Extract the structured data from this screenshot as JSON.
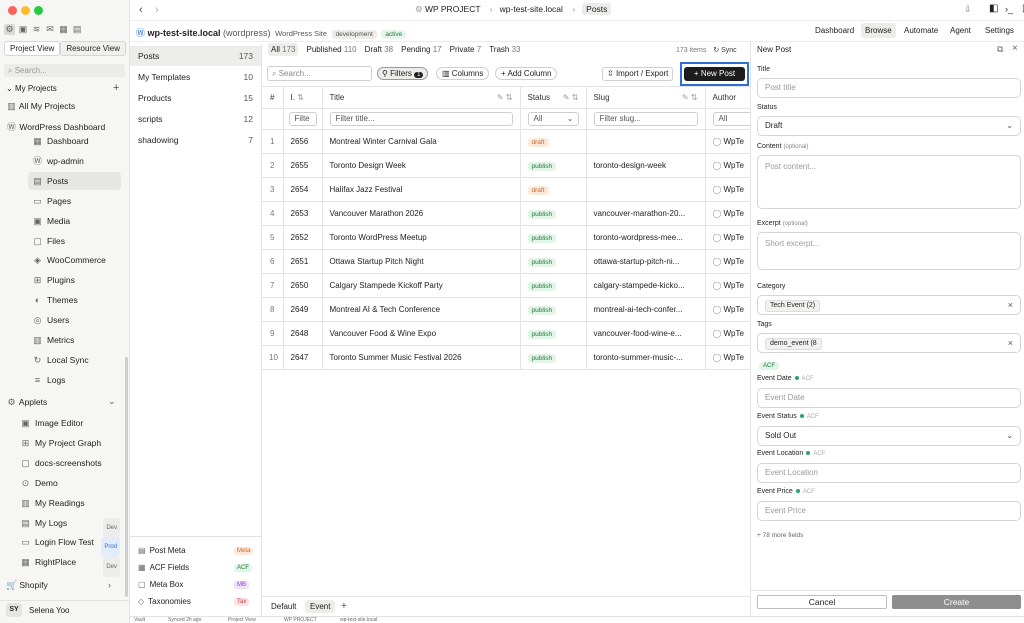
{
  "left": {
    "views": [
      "Project View",
      "Resource View"
    ],
    "search_placeholder": "Search...",
    "my_projects": "My Projects",
    "all_projects": "All My Projects",
    "project": "WordPress Dashboard",
    "items": [
      "Dashboard",
      "wp-admin",
      "Posts",
      "Pages",
      "Media",
      "Files",
      "WooCommerce",
      "Plugins",
      "Themes",
      "Users",
      "Metrics",
      "Local Sync",
      "Logs"
    ],
    "applets_label": "Applets",
    "applets": [
      {
        "label": "Image Editor",
        "badge": ""
      },
      {
        "label": "My Project Graph",
        "badge": ""
      },
      {
        "label": "docs-screenshots",
        "badge": ""
      },
      {
        "label": "Demo",
        "badge": ""
      },
      {
        "label": "My Readings",
        "badge": ""
      },
      {
        "label": "My Logs",
        "badge": "Dev"
      },
      {
        "label": "Login Flow Test",
        "badge": "Prod"
      },
      {
        "label": "RightPlace",
        "badge": "Dev"
      }
    ],
    "shopify": "Shopify",
    "user_initials": "SY",
    "user_name": "Selena Yoo"
  },
  "topbar": {
    "project": "WP PROJECT",
    "site": "wp-test-site.local",
    "page": "Posts",
    "site_name": "wp-test-site.local",
    "site_type": "(wordpress)",
    "site_label": "WordPress Site",
    "env": "development",
    "state": "active",
    "tabs": [
      "Dashboard",
      "Browse",
      "Automate",
      "Agent",
      "Settings"
    ]
  },
  "types": [
    {
      "label": "Posts",
      "count": "173"
    },
    {
      "label": "My Templates",
      "count": "10"
    },
    {
      "label": "Products",
      "count": "15"
    },
    {
      "label": "scripts",
      "count": "12"
    },
    {
      "label": "shadowing",
      "count": "7"
    }
  ],
  "bottom_types": [
    {
      "label": "Post Meta",
      "tag": "Meta"
    },
    {
      "label": "ACF Fields",
      "tag": "ACF"
    },
    {
      "label": "Meta Box",
      "tag": "MB"
    },
    {
      "label": "Taxonomies",
      "tag": "Tax"
    }
  ],
  "status_tabs": [
    {
      "label": "All",
      "count": "173"
    },
    {
      "label": "Published",
      "count": "110"
    },
    {
      "label": "Draft",
      "count": "38"
    },
    {
      "label": "Pending",
      "count": "17"
    },
    {
      "label": "Private",
      "count": "7"
    },
    {
      "label": "Trash",
      "count": "33"
    }
  ],
  "items_count": "173 items",
  "sync_label": "Sync",
  "toolbar": {
    "search_placeholder": "Search...",
    "filters": "Filters",
    "filters_count": "1",
    "columns": "Columns",
    "add_column": "+ Add Column",
    "import_export": "Import / Export",
    "new_post": "+ New Post"
  },
  "table": {
    "headers": [
      "#",
      "I.",
      "Title",
      "Status",
      "Slug",
      "Author"
    ],
    "filters": [
      "Filte",
      "Filter title...",
      "All",
      "Filter slug...",
      "All"
    ],
    "rows": [
      {
        "n": "1",
        "id": "2656",
        "title": "Montreal Winter Carnival Gala",
        "status": "draft",
        "slug": "",
        "author": "WpTe"
      },
      {
        "n": "2",
        "id": "2655",
        "title": "Toronto Design Week",
        "status": "publish",
        "slug": "toronto-design-week",
        "author": "WpTe"
      },
      {
        "n": "3",
        "id": "2654",
        "title": "Halifax Jazz Festival",
        "status": "draft",
        "slug": "",
        "author": "WpTe"
      },
      {
        "n": "4",
        "id": "2653",
        "title": "Vancouver Marathon 2026",
        "status": "publish",
        "slug": "vancouver-marathon-20...",
        "author": "WpTe"
      },
      {
        "n": "5",
        "id": "2652",
        "title": "Toronto WordPress Meetup",
        "status": "publish",
        "slug": "toronto-wordpress-mee...",
        "author": "WpTe"
      },
      {
        "n": "6",
        "id": "2651",
        "title": "Ottawa Startup Pitch Night",
        "status": "publish",
        "slug": "ottawa-startup-pitch-ni...",
        "author": "WpTe"
      },
      {
        "n": "7",
        "id": "2650",
        "title": "Calgary Stampede Kickoff Party",
        "status": "publish",
        "slug": "calgary-stampede-kicko...",
        "author": "WpTe"
      },
      {
        "n": "8",
        "id": "2649",
        "title": "Montreal AI & Tech Conference",
        "status": "publish",
        "slug": "montreal-ai-tech-confer...",
        "author": "WpTe"
      },
      {
        "n": "9",
        "id": "2648",
        "title": "Vancouver Food & Wine Expo",
        "status": "publish",
        "slug": "vancouver-food-wine-e...",
        "author": "WpTe"
      },
      {
        "n": "10",
        "id": "2647",
        "title": "Toronto Summer Music Festival 2026",
        "status": "publish",
        "slug": "toronto-summer-music-...",
        "author": "WpTe"
      }
    ]
  },
  "bottom_tabs": [
    "Default",
    "Event",
    "+"
  ],
  "panel": {
    "title": "New Post",
    "title_label": "Title",
    "title_placeholder": "Post title",
    "status_label": "Status",
    "status_value": "Draft",
    "content_label": "Content",
    "optional": "(optional)",
    "content_placeholder": "Post content...",
    "excerpt_label": "Excerpt",
    "excerpt_placeholder": "Short excerpt...",
    "category_label": "Category",
    "category_chip": "Tech Event (2)",
    "tags_label": "Tags",
    "tags_chip": "demo_event (8",
    "acf_tag": "ACF",
    "fields": [
      {
        "label": "Event Date",
        "value": "Event Date",
        "kind": "input"
      },
      {
        "label": "Event Status",
        "value": "Sold Out",
        "kind": "select"
      },
      {
        "label": "Event Location",
        "value": "Event Location",
        "kind": "input"
      },
      {
        "label": "Event Price",
        "value": "Event Price",
        "kind": "input"
      }
    ],
    "more_fields": "+ 78 more fields",
    "cancel": "Cancel",
    "create": "Create"
  },
  "statusbar": [
    "Vault",
    "Synced 2h ago",
    "Project View",
    "WP PROJECT",
    "wp-test-site.local"
  ],
  "colors": {
    "accent": "#2d6fd6",
    "publish": "#1e7a3c",
    "draft": "#c56a2e",
    "dark_button": "#1c1c1c",
    "create": "#8e8e8e"
  }
}
